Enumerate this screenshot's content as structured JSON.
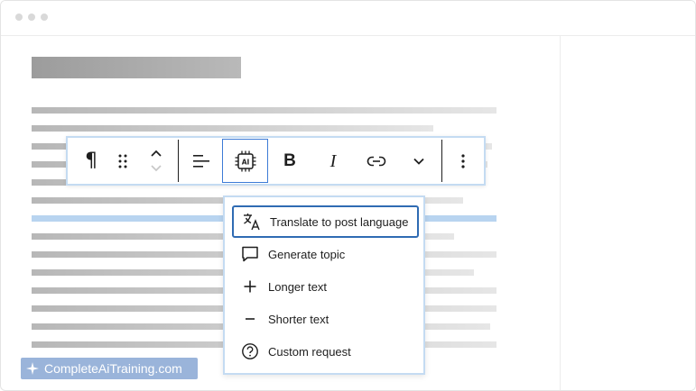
{
  "window": {
    "title_dots": [
      "dot",
      "dot",
      "dot"
    ]
  },
  "toolbar": {
    "buttons": [
      {
        "name": "paragraph",
        "icon": "pilcrow-icon",
        "glyph": "¶"
      },
      {
        "name": "drag",
        "icon": "drag-handle-icon"
      },
      {
        "name": "move",
        "icon": "move-up-down-icon"
      },
      {
        "name": "align",
        "icon": "align-left-icon"
      },
      {
        "name": "ai",
        "icon": "ai-chip-icon",
        "text": "AI",
        "active": true
      },
      {
        "name": "bold",
        "icon": "bold-icon",
        "glyph": "B"
      },
      {
        "name": "italic",
        "icon": "italic-icon",
        "glyph": "I"
      },
      {
        "name": "link",
        "icon": "link-icon"
      },
      {
        "name": "more-rich-text",
        "icon": "chevron-down-icon"
      },
      {
        "name": "options",
        "icon": "more-vertical-icon"
      }
    ]
  },
  "menu": {
    "items": [
      {
        "label": "Translate to post language",
        "icon": "translate-icon",
        "focused": true
      },
      {
        "label": "Generate topic",
        "icon": "speech-bubble-icon"
      },
      {
        "label": "Longer text",
        "icon": "plus-icon"
      },
      {
        "label": "Shorter text",
        "icon": "minus-icon"
      },
      {
        "label": "Custom request",
        "icon": "help-circle-icon"
      }
    ]
  },
  "watermark": {
    "text": "CompleteAiTraining.com",
    "icon": "sparkle-icon"
  },
  "colors": {
    "accent": "#3d7bd6",
    "toolbar_border": "#c4dbf2",
    "highlight_line": "#b8d4f0"
  }
}
